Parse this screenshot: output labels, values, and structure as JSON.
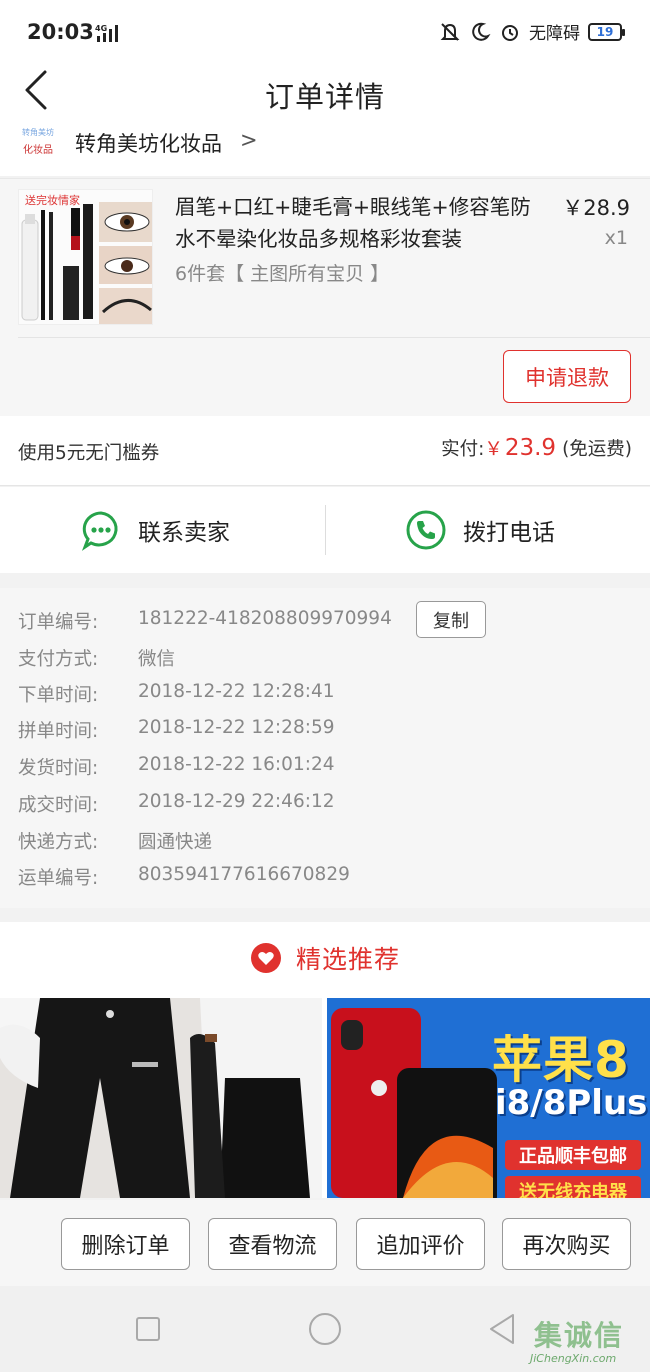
{
  "status_bar": {
    "time": "20:03",
    "network": "4G",
    "accessibility_label": "无障碍",
    "battery_level": "19"
  },
  "nav": {
    "title": "订单详情"
  },
  "shop": {
    "logo_text_top": "转角美坊",
    "logo_text_bottom": "化妆品",
    "name": "转角美坊化妆品",
    "chevron": ">"
  },
  "product": {
    "image_banner_text": "送完妆情家",
    "name": "眉笔+口红+睫毛膏+眼线笔+修容笔防水不晕染化妆品多规格彩妆套装",
    "sku": "6件套【 主图所有宝贝 】",
    "price": "￥28.9",
    "quantity": "x1",
    "refund_label": "申请退款"
  },
  "payment": {
    "coupon": "使用5元无门槛券",
    "paid_label": "实付:",
    "currency": "￥",
    "paid_amount": "23.9",
    "shipping_note": "(免运费)"
  },
  "contact": {
    "seller_label": "联系卖家",
    "phone_label": "拨打电话"
  },
  "order_info": {
    "copy_label": "复制",
    "rows": [
      {
        "label": "订单编号:",
        "value": "181222-418208809970994"
      },
      {
        "label": "支付方式:",
        "value": "微信"
      },
      {
        "label": "下单时间:",
        "value": "2018-12-22 12:28:41"
      },
      {
        "label": "拼单时间:",
        "value": "2018-12-22 12:28:59"
      },
      {
        "label": "发货时间:",
        "value": "2018-12-22 16:01:24"
      },
      {
        "label": "成交时间:",
        "value": "2018-12-29 22:46:12"
      },
      {
        "label": "快递方式:",
        "value": "圆通快递"
      },
      {
        "label": "运单编号:",
        "value": "803594177616670829"
      }
    ]
  },
  "recommend": {
    "title": "精选推荐",
    "right_card": {
      "headline": "苹果8",
      "subline": "i8/8Plus",
      "badge1": "正品顺丰包邮",
      "badge2": "送无线充电器"
    }
  },
  "actions": {
    "delete": "删除订单",
    "logistics": "查看物流",
    "review": "追加评价",
    "rebuy": "再次购买"
  },
  "watermark": {
    "main": "集诚信",
    "sub": "JiChengXin.com"
  },
  "colors": {
    "accent_red": "#e0322e",
    "wechat_green": "#27a34a"
  }
}
